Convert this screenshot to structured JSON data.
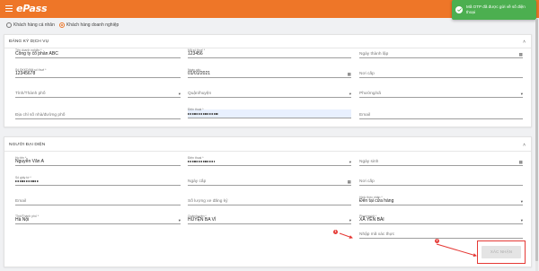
{
  "app": {
    "brand": "ePass"
  },
  "toast": {
    "message": "Mã OTP đã được gửi về số điện thoại"
  },
  "customer_type": {
    "personal": "Khách hàng cá nhân",
    "business": "Khách hàng doanh nghiệp",
    "selected": "business"
  },
  "registration": {
    "title": "ĐĂNG KÝ DỊCH VỤ",
    "company_name": {
      "label": "Tên doanh nghiệp *",
      "value": "Công ty cổ phần ABC"
    },
    "tax_code": {
      "label": "Mã số thuế *",
      "value": "123456"
    },
    "founding_date": {
      "placeholder": "Ngày thành lập"
    },
    "business_reg_no": {
      "label": "Số ĐKKD/Mã số thuế *",
      "value": "12345678"
    },
    "issue_date": {
      "label": "Ngày cấp",
      "value": "01/01/2021"
    },
    "issue_place": {
      "placeholder": "Nơi cấp"
    },
    "province": {
      "placeholder": "Tỉnh/Thành phố"
    },
    "district": {
      "placeholder": "Quận/huyện"
    },
    "ward": {
      "placeholder": "Phường/xã"
    },
    "address": {
      "placeholder": "Địa chỉ số nhà/đường phố"
    },
    "phone": {
      "label": "Điện thoại *"
    },
    "email": {
      "placeholder": "Email"
    }
  },
  "representative": {
    "title": "NGƯỜI ĐẠI DIỆN",
    "full_name": {
      "label": "Họ tên *",
      "value": "Nguyễn Văn A"
    },
    "phone": {
      "label": "Điện thoại *"
    },
    "birth_date": {
      "placeholder": "Ngày sinh"
    },
    "id_number": {
      "label": "Số giấy tờ *"
    },
    "id_issue_date": {
      "placeholder": "Ngày cấp"
    },
    "id_issue_place": {
      "placeholder": "Nơi cấp"
    },
    "email": {
      "placeholder": "Email"
    },
    "vehicle_count": {
      "placeholder": "Số lượng xe đăng ký"
    },
    "receive_method": {
      "label": "Hình thức nhận *",
      "value": "Đến tại cửa hàng"
    },
    "province": {
      "label": "Tỉnh/Thành phố *",
      "value": "Hà Nội"
    },
    "district": {
      "label": "Quận/huyện *",
      "value": "HUYỆN BA VÌ"
    },
    "ward": {
      "label": "Phường/xã *",
      "value": "XÃ YÊN BÀI"
    },
    "otp": {
      "placeholder": "Nhập mã xác thực"
    }
  },
  "steps": {
    "step1": "1",
    "step2": "2"
  },
  "confirm_button": "XÁC NHẬN",
  "colors": {
    "brand": "#ee7628",
    "toast": "#4caf50",
    "highlight": "#e53935"
  }
}
